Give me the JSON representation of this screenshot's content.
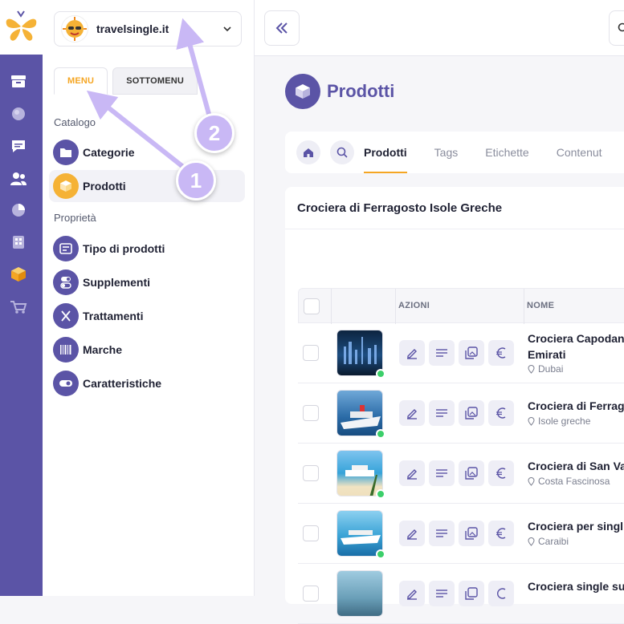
{
  "site": {
    "name": "travelsingle.it"
  },
  "sidebar_tabs": {
    "menu": "MENU",
    "submenu": "SOTTOMENU"
  },
  "sections": {
    "catalog": "Catalogo",
    "properties": "Proprietà"
  },
  "catalog_items": [
    {
      "label": "Categorie",
      "icon": "folder-icon"
    },
    {
      "label": "Prodotti",
      "icon": "box-icon"
    }
  ],
  "property_items": [
    {
      "label": "Tipo di prodotti",
      "icon": "card-icon"
    },
    {
      "label": "Supplementi",
      "icon": "toggle-icon"
    },
    {
      "label": "Trattamenti",
      "icon": "cutlery-icon"
    },
    {
      "label": "Marche",
      "icon": "barcode-icon"
    },
    {
      "label": "Caratteristiche",
      "icon": "switch-icon"
    }
  ],
  "page": {
    "title": "Prodotti"
  },
  "page_tabs": [
    "Prodotti",
    "Tags",
    "Etichette",
    "Contenut"
  ],
  "card": {
    "title": "Crociera di Ferragosto Isole Greche"
  },
  "table": {
    "headers": {
      "actions": "AZIONI",
      "name": "NOME"
    },
    "rows": [
      {
        "name1": "Crociera Capodan",
        "name2": "Emirati",
        "location": "Dubai"
      },
      {
        "name1": "Crociera di Ferrag",
        "name2": "",
        "location": "Isole greche"
      },
      {
        "name1": "Crociera di San Va",
        "name2": "",
        "location": "Costa Fascinosa"
      },
      {
        "name1": "Crociera per singl",
        "name2": "",
        "location": "Caraibi"
      },
      {
        "name1": "Crociera single su",
        "name2": "",
        "location": ""
      }
    ]
  },
  "annotations": {
    "one": "1",
    "two": "2"
  },
  "colors": {
    "accent": "#5b54a6",
    "highlight": "#f5a623",
    "status": "#3ccf6a",
    "annotation": "#c9b8f5"
  }
}
